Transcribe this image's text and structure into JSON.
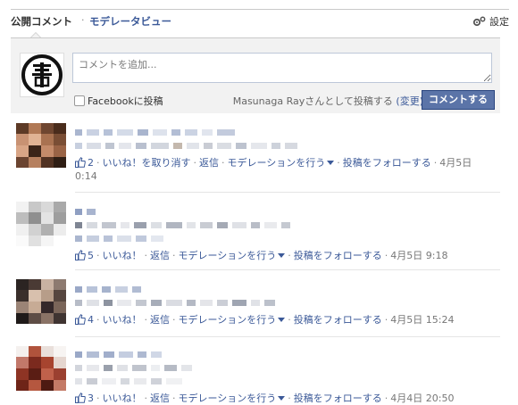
{
  "tabs": {
    "public": "公開コメント",
    "separator": "·",
    "moderator": "モデレータビュー",
    "settings": "設定"
  },
  "composer": {
    "placeholder": "コメントを追加...",
    "facebook_label": "Facebookに投稿",
    "posting_as": "Masunaga Rayさんとして投稿する",
    "change": "(変更)",
    "submit": "コメントする"
  },
  "comments": [
    {
      "likes": "2",
      "like_action": "いいね！を取り消す",
      "reply": "返信",
      "moderate": "モデレーションを行う",
      "follow": "投稿をフォローする",
      "date": "4月5日",
      "time": "0:14"
    },
    {
      "likes": "5",
      "like_action": "いいね！",
      "reply": "返信",
      "moderate": "モデレーションを行う",
      "follow": "投稿をフォローする",
      "date": "4月5日",
      "time": "9:18"
    },
    {
      "likes": "4",
      "like_action": "いいね！",
      "reply": "返信",
      "moderate": "モデレーションを行う",
      "follow": "投稿をフォローする",
      "date": "4月5日",
      "time": "15:24"
    },
    {
      "likes": "3",
      "like_action": "いいね！",
      "reply": "返信",
      "moderate": "モデレーションを行う",
      "follow": "投稿をフォローする",
      "date": "4月4日",
      "time": "20:50"
    }
  ],
  "icons": {
    "settings": "gear-icon",
    "like": "thumbs-up-icon",
    "dropdown": "chevron-down-icon"
  },
  "colors": {
    "link": "#3b5998",
    "button": "#5b74a8"
  }
}
